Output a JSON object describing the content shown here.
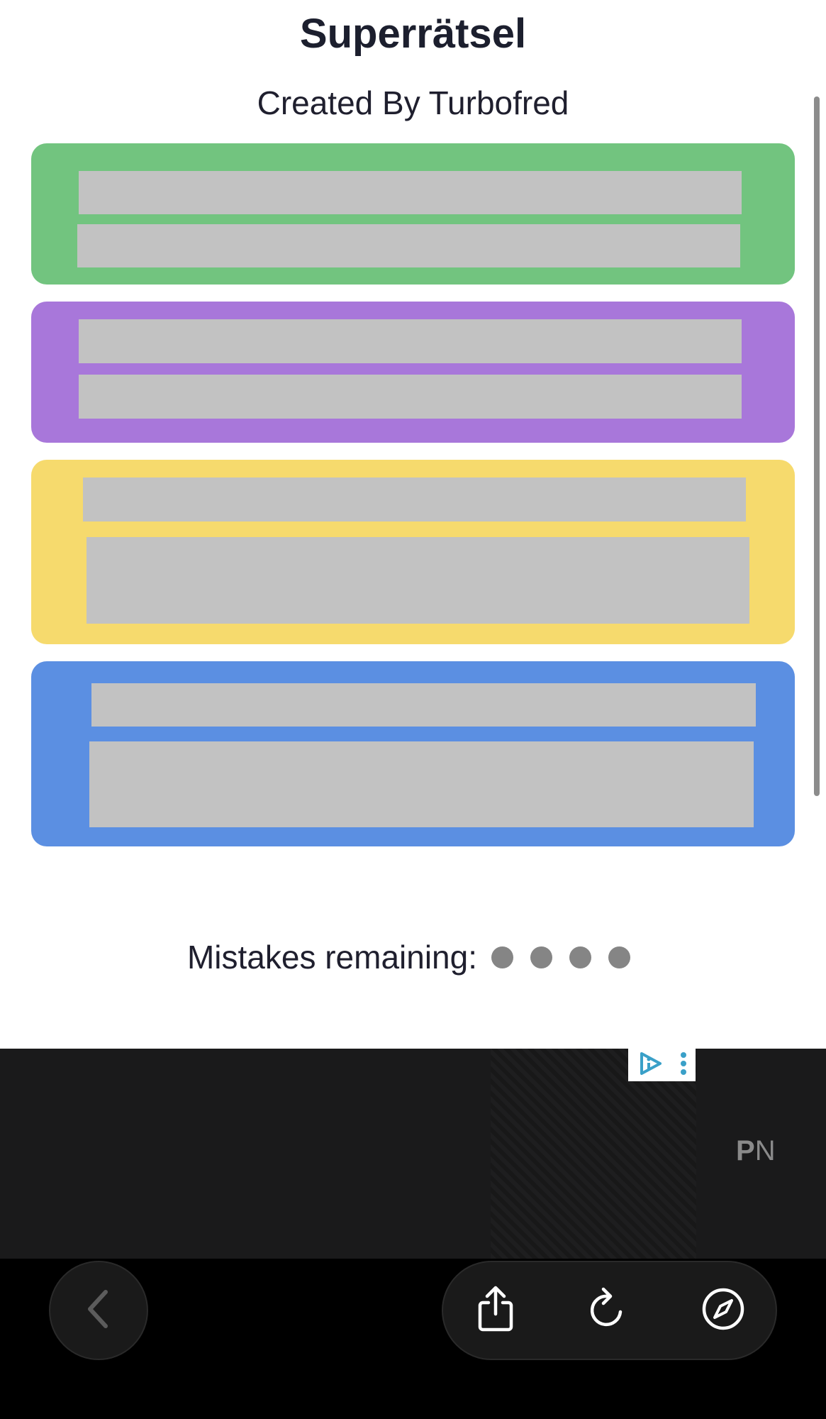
{
  "header": {
    "title": "Superrätsel",
    "subtitle": "Created By Turbofred"
  },
  "groups": [
    {
      "color": "#72c47f",
      "tiles": 2
    },
    {
      "color": "#a877da",
      "tiles": 2
    },
    {
      "color": "#f6da6d",
      "tiles": 2
    },
    {
      "color": "#5b8fe2",
      "tiles": 2
    }
  ],
  "status": {
    "mistakes_label": "Mistakes remaining:",
    "mistakes_remaining": 4
  },
  "ad": {
    "brand_bold": "P",
    "brand_regular": "N",
    "badge_icons": [
      "adchoices-icon",
      "more-vertical-icon"
    ]
  },
  "browser_toolbar": {
    "buttons": [
      "back-icon",
      "share-icon",
      "reload-icon",
      "compass-icon"
    ]
  }
}
